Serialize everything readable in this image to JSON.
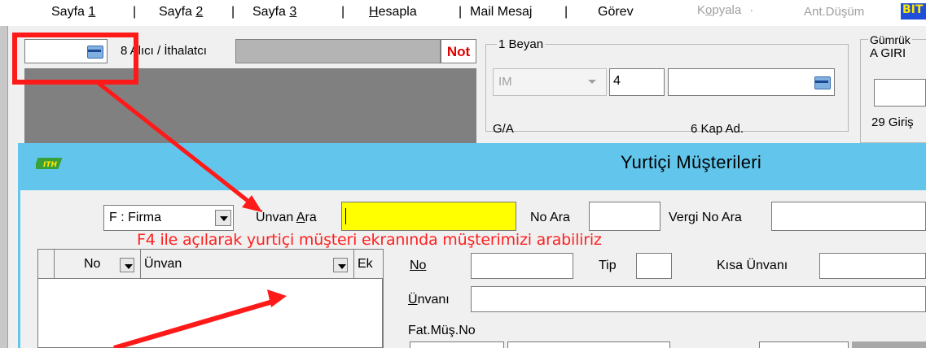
{
  "tabs": [
    {
      "pre": "Sayfa ",
      "ul": "1",
      "post": ""
    },
    {
      "pre": "Sayfa ",
      "ul": "2",
      "post": ""
    },
    {
      "pre": "Sayfa ",
      "ul": "3",
      "post": ""
    },
    {
      "pre": "",
      "ul": "H",
      "post": "esapla"
    },
    {
      "pre": "Mail Mesaj",
      "ul": "",
      "post": ""
    },
    {
      "pre": "Görev",
      "ul": "",
      "post": ""
    }
  ],
  "disabled_tabs": {
    "kopyala_pre": "K",
    "kopyala_ul": "o",
    "kopyala_post": "pyala",
    "ant_dusum": "Ant.Düşüm"
  },
  "bit_badge": "BIT",
  "form": {
    "alici_label": "8 Alıcı / İthalatcı",
    "not_label": "Not",
    "beyan_group": "1 Beyan",
    "beyan_type": "IM",
    "beyan_no": "4",
    "gumruk_group": "Gümrük",
    "gumruk_value": "A GIRI",
    "ga_label": "G/A",
    "kap_label": "6 Kap Ad.",
    "giris_label": "29 Giriş"
  },
  "dialog": {
    "title": "Yurtiçi Müşterileri",
    "filter_value": "F : Firma",
    "unvan_ara_pre": "Ü",
    "unvan_ara_mid": "nvan ",
    "unvan_ara_ul": "A",
    "unvan_ara_post": "ra",
    "no_ara_label": "No Ara",
    "vergi_no_ara_label": "Vergi No Ara",
    "grid_columns": [
      "No",
      "Ünvan",
      "Ek"
    ],
    "detail": {
      "no_label": "No",
      "tip_label": "Tip",
      "kisa_unvan_label": "Kısa Ünvanı",
      "unvan_label": "Ünvanı",
      "fat_mus_no_label": "Fat.Müş.No"
    }
  },
  "annotation_text": "F4 ile açılarak yurtiçi müşteri ekranında müşterimizi arabiliriz",
  "colors": {
    "accent": "#62c6ec",
    "highlight": "#ffff00",
    "annotation": "#ff1a1a"
  }
}
